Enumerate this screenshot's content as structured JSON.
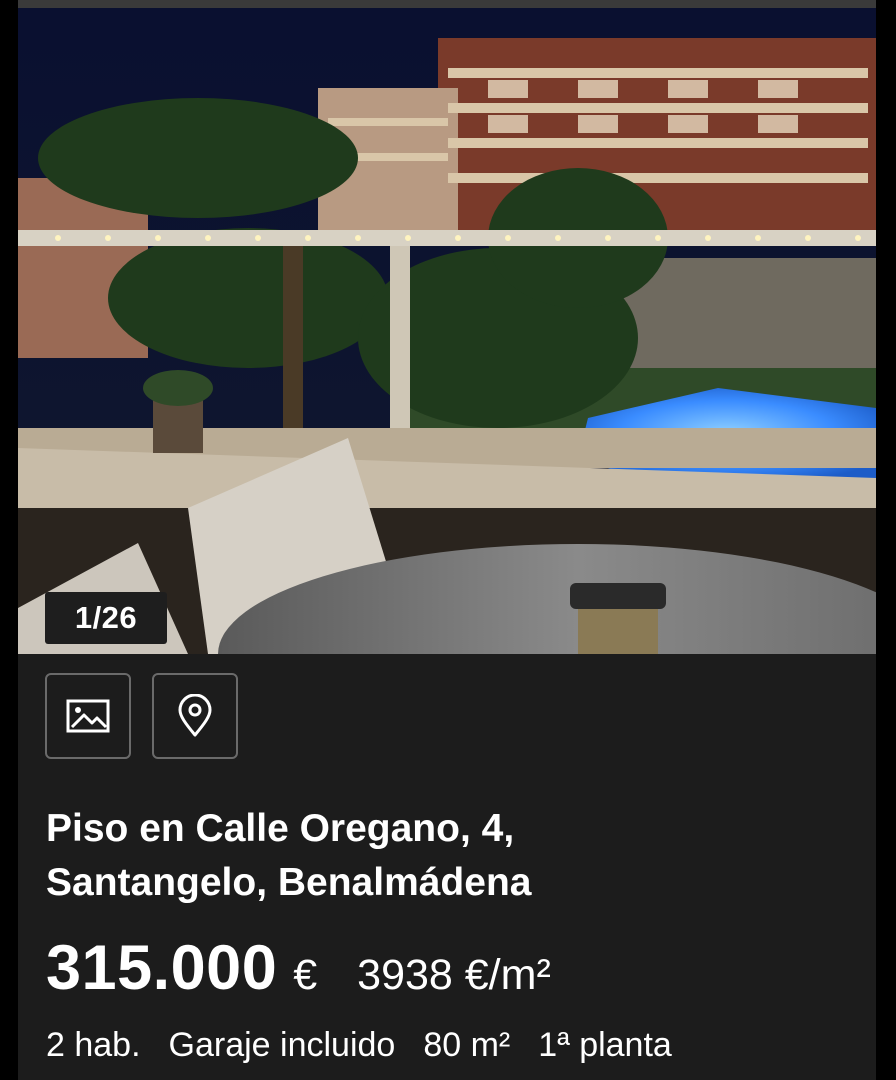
{
  "listing": {
    "photo_counter": "1/26",
    "title_line1": "Piso en Calle Oregano, 4,",
    "title_line2": "Santangelo, Benalmádena",
    "price": "315.000",
    "currency": "€",
    "price_per_m2": "3938 €/m²",
    "features": {
      "rooms": "2 hab.",
      "garage": "Garaje incluido",
      "area": "80 m²",
      "floor": "1ª planta"
    }
  },
  "actions": {
    "gallery_icon": "image-icon",
    "map_icon": "location-pin-icon"
  },
  "colors": {
    "card_background": "#1c1c1c",
    "pool": "#3a8cff",
    "button_border": "#6a6a6a"
  }
}
